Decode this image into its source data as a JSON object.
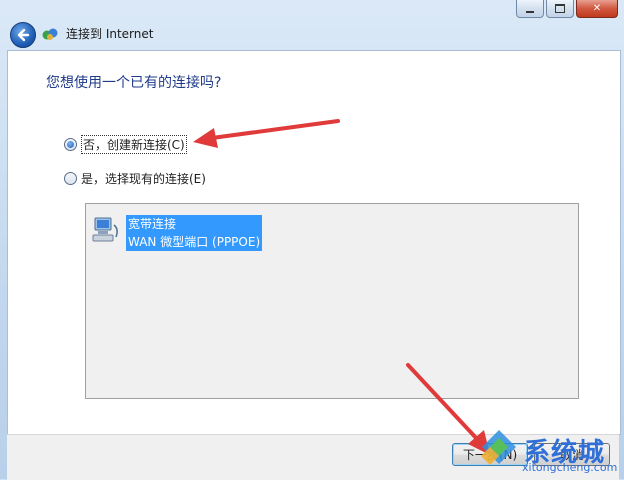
{
  "window": {
    "title": "连接到 Internet",
    "caption_buttons": {
      "minimize_icon": "minimize-icon",
      "maximize_icon": "maximize-icon",
      "close_symbol": "✕"
    }
  },
  "header": {
    "back_icon": "back-arrow-icon",
    "app_icon": "network-globe-icon"
  },
  "content": {
    "question": "您想使用一个已有的连接吗?",
    "options": [
      {
        "label": "否，创建新连接(C)",
        "selected": true
      },
      {
        "label": "是，选择现有的连接(E)",
        "selected": false
      }
    ],
    "connections": [
      {
        "name": "宽带连接",
        "detail": "WAN 微型端口 (PPPOE)",
        "icon": "broadband-computer-icon",
        "selected": true
      }
    ]
  },
  "footer": {
    "next_label": "下一步(N)",
    "cancel_label": "取消"
  },
  "watermark": {
    "brand": "系统城",
    "url": "xitongcheng.com"
  },
  "colors": {
    "accent_blue": "#1f3b8a",
    "selection": "#3399ff",
    "annotation_arrow": "#e03a3a"
  }
}
